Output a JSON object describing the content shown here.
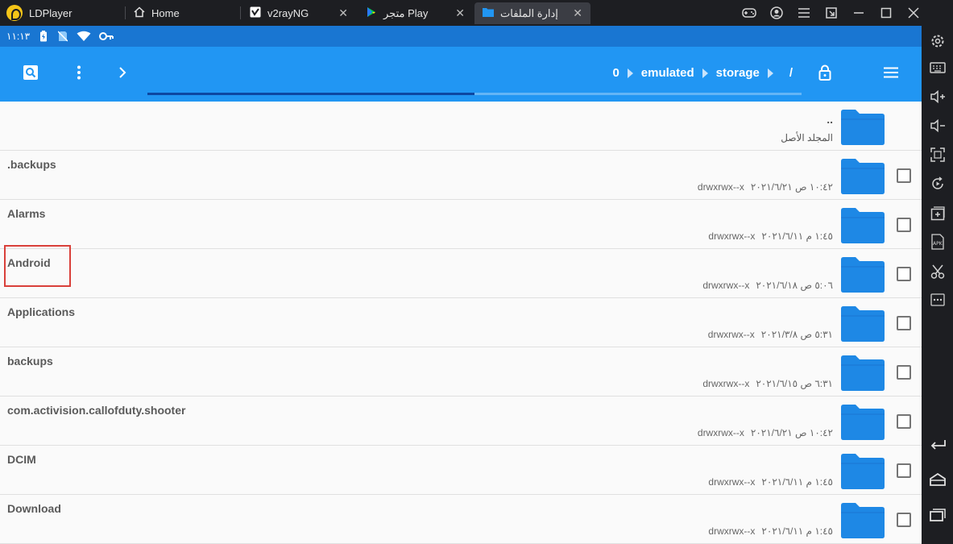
{
  "titlebar": {
    "app_name": "LDPlayer",
    "tabs": [
      {
        "label": "Home",
        "icon": "home-icon"
      },
      {
        "label": "v2rayNG",
        "icon": "v2rayng-icon"
      },
      {
        "label": "متجر Play",
        "icon": "play-store-icon"
      },
      {
        "label": "إدارة الملفات",
        "icon": "folder-icon",
        "active": true
      }
    ],
    "window_controls": [
      "gamepad-icon",
      "account-icon",
      "menu-icon",
      "popout-icon",
      "minimize-icon",
      "maximize-icon",
      "close-icon"
    ]
  },
  "statusbar": {
    "time": "١١:١٣",
    "icons": [
      "battery-charging-icon",
      "no-sim-icon",
      "wifi-icon",
      "vpn-key-icon"
    ]
  },
  "toolbar": {
    "breadcrumb": [
      "0",
      "emulated",
      "storage",
      "/"
    ],
    "buttons": [
      "search-icon",
      "more-vert-icon",
      "chevron-right-icon",
      "lock-icon",
      "hamburger-icon"
    ],
    "progress": 0.5
  },
  "file_list": {
    "parent": {
      "name": "..",
      "label": "المجلد الأصل"
    },
    "items": [
      {
        "name": ".backups",
        "perms": "drwxrwx--x",
        "date": "١٠:٤٢ ص ٢٠٢١/٦/٢١"
      },
      {
        "name": "Alarms",
        "perms": "drwxrwx--x",
        "date": "١:٤٥ م ٢٠٢١/٦/١١"
      },
      {
        "name": "Android",
        "perms": "drwxrwx--x",
        "date": "٥:٠٦ ص ٢٠٢١/٦/١٨"
      },
      {
        "name": "Applications",
        "perms": "drwxrwx--x",
        "date": "٥:٣١ ص ٢٠٢١/٣/٨"
      },
      {
        "name": "backups",
        "perms": "drwxrwx--x",
        "date": "٦:٣١ ص ٢٠٢١/٦/١٥"
      },
      {
        "name": "com.activision.callofduty.shooter",
        "perms": "drwxrwx--x",
        "date": "١٠:٤٢ ص ٢٠٢١/٦/٢١"
      },
      {
        "name": "DCIM",
        "perms": "drwxrwx--x",
        "date": "١:٤٥ م ٢٠٢١/٦/١١"
      },
      {
        "name": "Download",
        "perms": "drwxrwx--x",
        "date": "١:٤٥ م ٢٠٢١/٦/١١"
      }
    ]
  },
  "sidebar": {
    "buttons": [
      "settings-icon",
      "keyboard-icon",
      "volume-up-icon",
      "volume-down-icon",
      "fullscreen-icon",
      "rotate-icon",
      "add-window-icon",
      "apk-install-icon",
      "scissors-icon",
      "more-icon",
      "back-icon",
      "home-icon",
      "recents-icon"
    ]
  },
  "colors": {
    "toolbar": "#2196f3",
    "statusbar": "#1976d2",
    "folder": "#1e88e5",
    "highlight": "#d9403a"
  }
}
